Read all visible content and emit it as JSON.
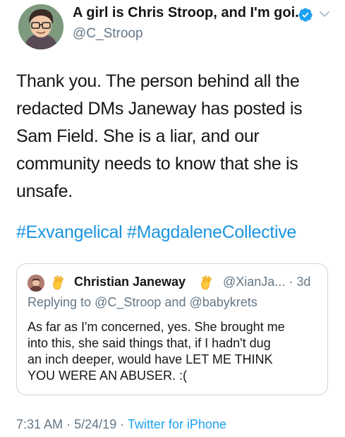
{
  "tweet": {
    "display_name": "A girl is Chris Stroop, and I'm goi...",
    "handle": "@C_Stroop",
    "verified_icon": "verified-badge-icon",
    "menu_icon": "chevron-down-icon",
    "text_lines": [
      "Thank you. The person behind all the",
      "redacted DMs Janeway has posted is",
      "Sam Field. She is a liar, and our",
      "community needs to know that she is",
      "unsafe."
    ],
    "hashtags": [
      "#Exvangelical",
      "#MagdaleneCollective"
    ],
    "timestamp": "7:31 AM",
    "date": "5/24/19",
    "separator": "·",
    "source": "Twitter for iPhone"
  },
  "quoted_tweet": {
    "name": "Christian Janeway",
    "emoji_icon": "vulcan-salute-icon",
    "handle": "@XianJa...",
    "separator": "·",
    "age": "3d",
    "replying_prefix": "Replying to",
    "replying_to": [
      "@C_Stroop",
      "@babykrets"
    ],
    "replying_joiner": "and",
    "text_lines": [
      "As far as I'm concerned, yes. She brought me",
      "into this, she said things that, if I hadn't dug",
      "an inch deeper, would have LET ME THINK",
      "YOU WERE AN ABUSER. :("
    ]
  },
  "colors": {
    "link": "#1da1f2",
    "text": "#14171a",
    "muted": "#657786",
    "border": "#ccd6dd",
    "emoji": "#ffc83d"
  }
}
